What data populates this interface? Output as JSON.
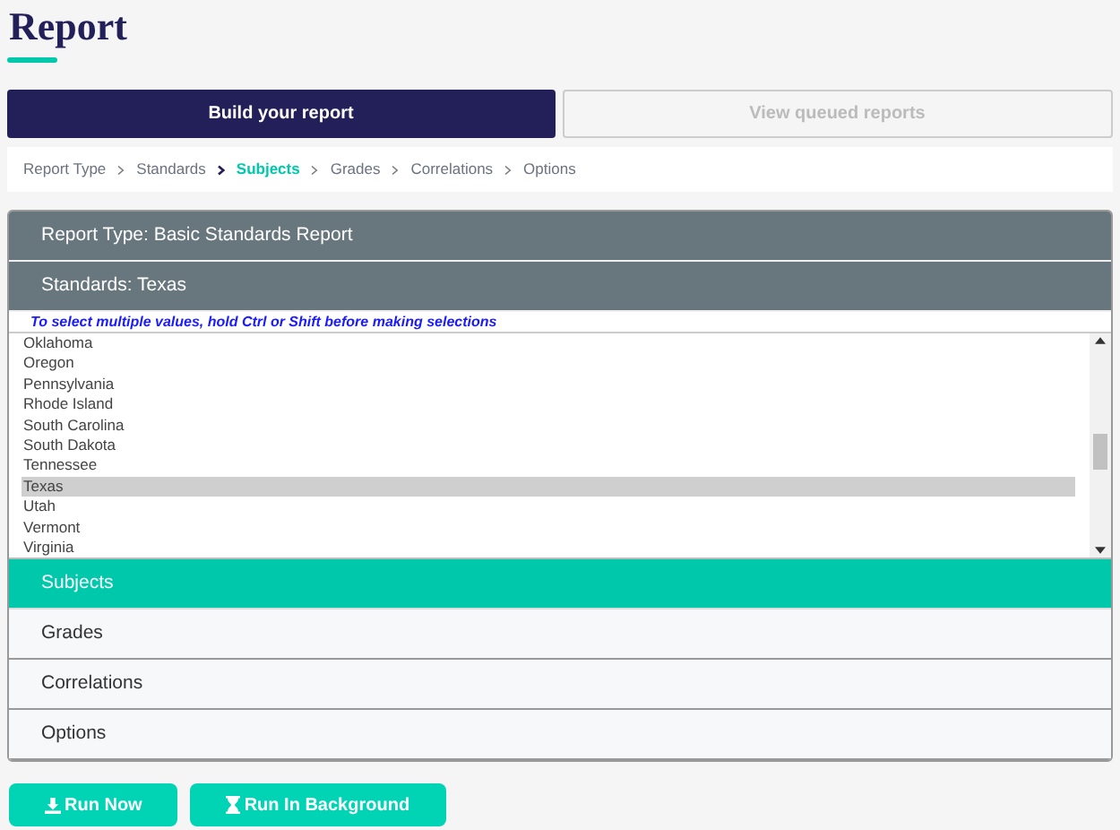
{
  "page_title": "Report",
  "tabs": [
    {
      "label": "Build your report",
      "selected": true
    },
    {
      "label": "View queued reports",
      "selected": false
    }
  ],
  "breadcrumb": [
    {
      "label": "Report Type",
      "selected": false
    },
    {
      "label": "Standards",
      "selected": false
    },
    {
      "label": "Subjects",
      "selected": true
    },
    {
      "label": "Grades",
      "selected": false
    },
    {
      "label": "Correlations",
      "selected": false
    },
    {
      "label": "Options",
      "selected": false
    }
  ],
  "sections": [
    {
      "kind": "done",
      "label": "Report Type: Basic Standards Report"
    },
    {
      "kind": "done",
      "label": "Standards: Texas",
      "hint": "To select multiple values, hold Ctrl or Shift before making selections",
      "options": [
        {
          "label": "Oklahoma",
          "selected": false
        },
        {
          "label": "Oregon",
          "selected": false
        },
        {
          "label": "Pennsylvania",
          "selected": false
        },
        {
          "label": "Rhode Island",
          "selected": false
        },
        {
          "label": "South Carolina",
          "selected": false
        },
        {
          "label": "South Dakota",
          "selected": false
        },
        {
          "label": "Tennessee",
          "selected": false
        },
        {
          "label": "Texas",
          "selected": true
        },
        {
          "label": "Utah",
          "selected": false
        },
        {
          "label": "Vermont",
          "selected": false
        },
        {
          "label": "Virginia",
          "selected": false
        }
      ]
    },
    {
      "kind": "current",
      "label": "Subjects"
    },
    {
      "kind": "pending",
      "label": "Grades"
    },
    {
      "kind": "pending",
      "label": "Correlations"
    },
    {
      "kind": "pending",
      "label": "Options"
    }
  ],
  "actions": [
    {
      "kind": "download",
      "label": "Run Now"
    },
    {
      "kind": "hourglass",
      "label": "Run In Background"
    }
  ]
}
